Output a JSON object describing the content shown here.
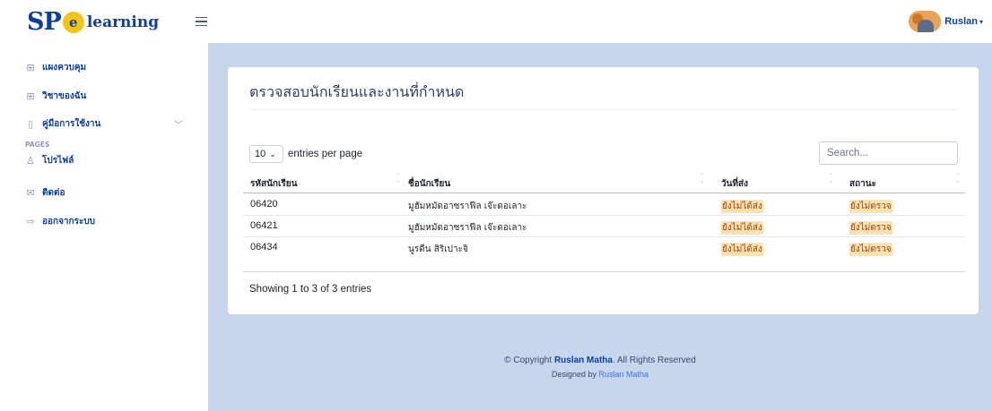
{
  "header": {
    "logo": {
      "sp": "SP",
      "e": "e",
      "text": "learning"
    },
    "user": {
      "name": "Ruslan",
      "caret": "▾"
    }
  },
  "sidebar": {
    "items": [
      {
        "label": "แผงควบคุม",
        "icon": "grid-icon",
        "glyph": "⊞"
      },
      {
        "label": "วิชาของฉัน",
        "icon": "grid-icon",
        "glyph": "⊞"
      },
      {
        "label": "คู่มือการใช้งาน",
        "icon": "book-icon",
        "glyph": "▯",
        "chevron": "﹀"
      }
    ],
    "heading": "PAGES",
    "page_items": [
      {
        "label": "โปรไฟล์",
        "icon": "person-icon",
        "glyph": "♙"
      },
      {
        "label": "ติดต่อ",
        "icon": "envelope-icon",
        "glyph": "✉"
      },
      {
        "label": "ออกจากระบบ",
        "icon": "logout-icon",
        "glyph": "⇨"
      }
    ]
  },
  "main": {
    "title": "ตรวจสอบนักเรียนและงานที่กำหนด",
    "per_page": {
      "value": "10",
      "caret": "⌄",
      "suffix": "entries per page"
    },
    "search": {
      "placeholder": "Search..."
    },
    "table": {
      "headers": [
        "รหัสนักเรียน",
        "ชื่อนักเรียน",
        "วันที่ส่ง",
        "สถานะ"
      ],
      "rows": [
        {
          "id": "06420",
          "name": "มูฮัมหมัดอาซราฟีล เจ๊ะดอเลาะ",
          "date": "ยังไม่ได้ส่ง",
          "status": "ยังไม่ตรวจ"
        },
        {
          "id": "06421",
          "name": "มูฮัมหมัดอาซราฟีล เจ๊ะดอเลาะ",
          "date": "ยังไม่ได้ส่ง",
          "status": "ยังไม่ตรวจ"
        },
        {
          "id": "06434",
          "name": "นูรดีน สิริเปาะจิ",
          "date": "ยังไม่ได้ส่ง",
          "status": "ยังไม่ตรวจ"
        }
      ]
    },
    "showing": "Showing 1 to 3 of 3 entries"
  },
  "footer": {
    "copyright_prefix": "© Copyright",
    "copyright_name": "Ruslan Matha",
    "copyright_suffix": ". All Rights Reserved",
    "designed_prefix": "Designed by",
    "designed_name": "Ruslan Matha"
  },
  "colors": {
    "brand": "#0e3f9c",
    "main_bg": "#c7d6ec",
    "badge_bg": "#fde2b0",
    "badge_text": "#a0410d"
  }
}
